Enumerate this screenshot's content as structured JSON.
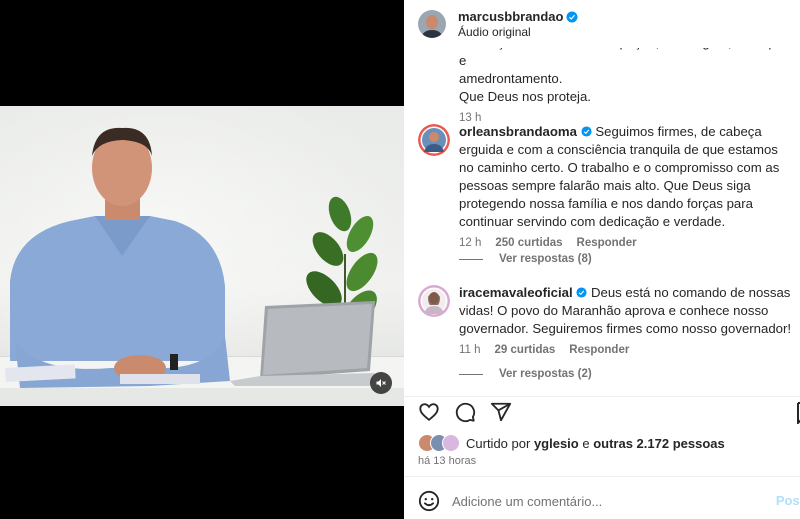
{
  "header": {
    "username": "marcusbbrandao",
    "subtitle": "Áudio original"
  },
  "top_comment": {
    "text_lines": [
      "JUSTIÇA não admite detur pação, chantagem, achaque e",
      "amedrontamento.",
      "Que Deus nos proteja."
    ],
    "time": "13 h"
  },
  "comments": [
    {
      "username": "orleansbrandaoma",
      "text": "Seguimos firmes, de cabeça erguida e com a consciência tranquila de que estamos no caminho certo. O trabalho e o compromisso com as pessoas sempre falarão mais alto. Que Deus siga protegendo nossa família e nos dando forças para continuar servindo com dedicação e verdade.",
      "time": "12 h",
      "likes": "250 curtidas",
      "reply": "Responder",
      "view_replies": "Ver respostas (8)"
    },
    {
      "username": "iracemavaleoficial",
      "text": "Deus está no comando de nossas vidas! O povo do Maranhão aprova e conhece nosso governador. Seguiremos firmes como nosso governador!",
      "time": "11 h",
      "likes": "29 curtidas",
      "reply": "Responder",
      "view_replies": "Ver respostas (2)"
    }
  ],
  "likes_summary": {
    "prefix": "Curtido por",
    "user": "yglesio",
    "middle": "e",
    "others": "outras 2.172 pessoas"
  },
  "post_time": "há 13 horas",
  "comment_box": {
    "placeholder": "Adicione um comentário...",
    "post_label": "Post"
  },
  "colors": {
    "verified": "#0095f6",
    "muted_text": "#737373",
    "post_disabled": "#b2dffc"
  },
  "icons": {
    "mute": "speaker-muted-icon",
    "like": "heart-icon",
    "comment": "speech-bubble-icon",
    "share": "paper-plane-icon",
    "save": "bookmark-icon",
    "emoji": "smiley-icon"
  }
}
